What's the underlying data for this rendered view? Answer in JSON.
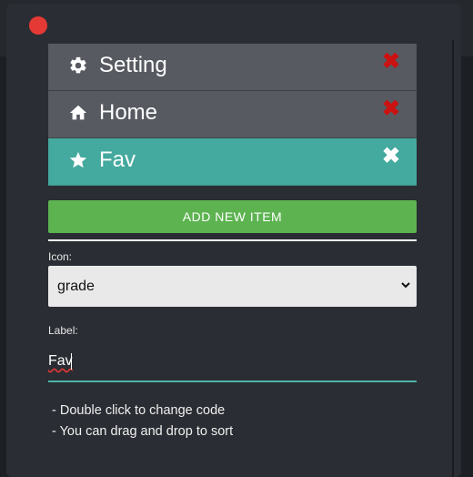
{
  "list": {
    "items": [
      {
        "icon": "gear-icon",
        "label": "Setting",
        "delete_icon": "close-icon"
      },
      {
        "icon": "home-icon",
        "label": "Home",
        "delete_icon": "close-icon"
      },
      {
        "icon": "star-icon",
        "label": "Fav",
        "delete_icon": "close-icon",
        "active": true
      }
    ]
  },
  "add_button_label": "ADD NEW ITEM",
  "icon_field": {
    "label": "Icon:",
    "value": "grade"
  },
  "label_field": {
    "label": "Label:",
    "value": "Fav"
  },
  "hints": [
    "- Double click to change code",
    "- You can drag and drop to sort"
  ],
  "colors": {
    "panel": "#2a2d33",
    "item": "#575a61",
    "active_item": "#44a99e",
    "add_button": "#5cb350",
    "delete_x": "#cc1111",
    "close_dot": "#e53935",
    "input_underline": "#4fb3a8"
  }
}
